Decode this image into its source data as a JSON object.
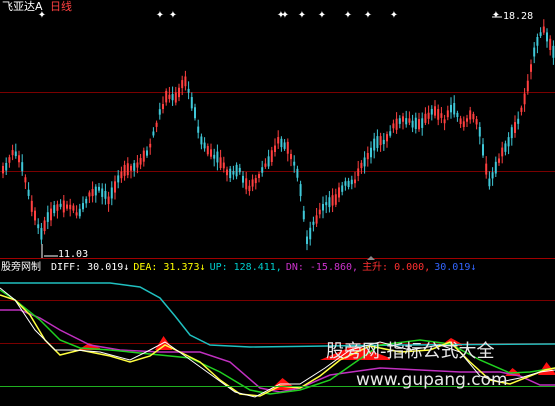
{
  "title": {
    "stock_name": "飞亚达A",
    "period": "日线"
  },
  "price_labels": {
    "high": "18.28",
    "low": "11.03"
  },
  "indicator_bar": {
    "name": "股旁网制",
    "items": [
      {
        "key": "diff",
        "label": "DIFF:",
        "value": "30.019",
        "arrow": "↓",
        "color": "#ffffff"
      },
      {
        "key": "dea",
        "label": "DEA:",
        "value": "31.373",
        "arrow": "↓",
        "color": "#ffff00"
      },
      {
        "key": "up",
        "label": "UP:",
        "value": "128.411,",
        "arrow": "",
        "color": "#00cccc"
      },
      {
        "key": "dn",
        "label": "DN:",
        "value": "-15.860,",
        "arrow": "",
        "color": "#cc33cc"
      },
      {
        "key": "zs",
        "label": "主升:",
        "value": "0.000,",
        "arrow": "",
        "color": "#ff3030"
      },
      {
        "key": "last",
        "label": "",
        "value": "30.019",
        "arrow": "↓",
        "color": "#3366ff"
      }
    ]
  },
  "watermark": {
    "title": "股旁网-指标公式大全",
    "url": "www.gupang.com"
  },
  "colors": {
    "up": "#ff4040",
    "down": "#40c8d8",
    "grid": "#7a0000",
    "lines": {
      "white": "#ffffff",
      "yellow": "#ffff40",
      "green": "#20d020",
      "magenta": "#c030c0",
      "cyan": "#20c0c0",
      "red": "#ff1010"
    }
  },
  "markers": {
    "top_event_count": 9
  }
}
